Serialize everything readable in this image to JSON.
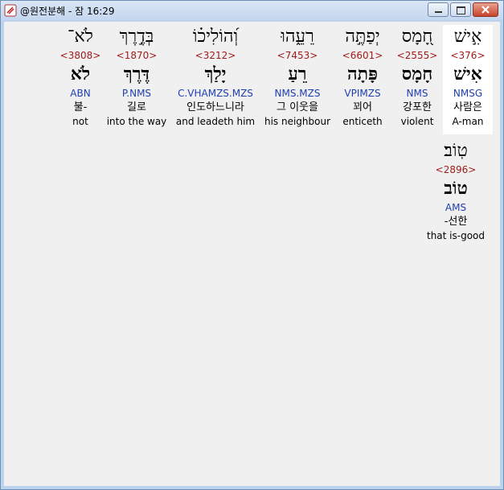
{
  "window": {
    "title": "@원전분해 - 잠 16:29"
  },
  "words": [
    {
      "hebrew": "אִ֣ישׁ",
      "strong": "<376>",
      "lemma": "אִישׁ",
      "morph": "NMSG",
      "korean": "사람은",
      "english": "A-man",
      "highlight": true
    },
    {
      "hebrew": "חָ֭מָס",
      "strong": "<2555>",
      "lemma": "חָמָס",
      "morph": "NMS",
      "korean": "강포한",
      "english": "violent",
      "highlight": false
    },
    {
      "hebrew": "יְפַתֶּ֣ה",
      "strong": "<6601>",
      "lemma": "פָּתָה",
      "morph": "VPIMZS",
      "korean": "꾀어",
      "english": "enticeth",
      "highlight": false
    },
    {
      "hebrew": "רֵעֵ֑הוּ",
      "strong": "<7453>",
      "lemma": "רֵעַ",
      "morph": "NMS.MZS",
      "korean": "그 이웃을",
      "english": "his neighbour",
      "highlight": false
    },
    {
      "hebrew": "וְ֝הוֹלִיכ֗וֹ",
      "strong": "<3212>",
      "lemma": "יָלַךְ",
      "morph": "C.VHAMZS.MZS",
      "korean": "인도하느니라",
      "english": "and leadeth him",
      "highlight": false
    },
    {
      "hebrew": "בְּדֶ֣רֶךְ",
      "strong": "<1870>",
      "lemma": "דֶּרֶךְ",
      "morph": "P.NMS",
      "korean": "길로",
      "english": "into the way",
      "highlight": false
    },
    {
      "hebrew": "לֹא־",
      "strong": "<3808>",
      "lemma": "לֹא",
      "morph": "ABN",
      "korean": "불-",
      "english": "not",
      "highlight": false
    },
    {
      "hebrew": "טֽוֹב׃",
      "strong": "<2896>",
      "lemma": "טוֹב",
      "morph": "AMS",
      "korean": "-선한",
      "english": "that is-good",
      "highlight": false
    }
  ]
}
